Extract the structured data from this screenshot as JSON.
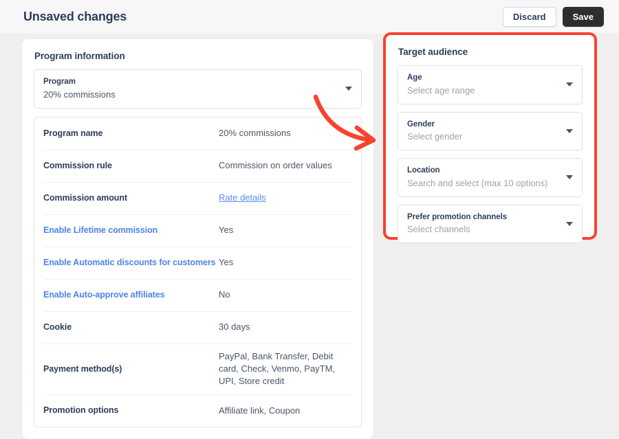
{
  "header": {
    "title": "Unsaved changes",
    "discard_label": "Discard",
    "save_label": "Save"
  },
  "colors": {
    "page_background": "#efeff0",
    "header_background": "#f7f7f8",
    "card_background": "#ffffff",
    "title_text": "#2e3d5c",
    "body_text": "#4a5568",
    "placeholder_text": "#9aa2b0",
    "link_blue": "#5b8def",
    "key_link_blue": "#4f83e8",
    "highlight_red": "#f8432e",
    "save_button_background": "#2e2e30",
    "border": "#dfe1e6"
  },
  "left_panel": {
    "title": "Program information",
    "program_select": {
      "label": "Program",
      "value": "20% commissions",
      "caret_icon": "chevron-down-icon"
    },
    "info_rows": [
      {
        "key": "Program name",
        "key_style": "normal",
        "value": "20% commissions",
        "value_type": "text"
      },
      {
        "key": "Commission rule",
        "key_style": "normal",
        "value": "Commission on order values",
        "value_type": "text"
      },
      {
        "key": "Commission amount",
        "key_style": "normal",
        "value": "Rate details",
        "value_type": "link"
      },
      {
        "key": "Enable Lifetime commission",
        "key_style": "link",
        "value": "Yes",
        "value_type": "text"
      },
      {
        "key": "Enable Automatic discounts for customers",
        "key_style": "link",
        "value": "Yes",
        "value_type": "text"
      },
      {
        "key": "Enable Auto-approve affiliates",
        "key_style": "link",
        "value": "No",
        "value_type": "text"
      },
      {
        "key": "Cookie",
        "key_style": "normal",
        "value": "30 days",
        "value_type": "text"
      },
      {
        "key": "Payment method(s)",
        "key_style": "normal",
        "value": "PayPal, Bank Transfer, Debit card, Check, Venmo, PayTM, UPI, Store credit",
        "value_type": "text"
      },
      {
        "key": "Promotion options",
        "key_style": "normal",
        "value": "Affiliate link, Coupon",
        "value_type": "text"
      }
    ]
  },
  "right_panel": {
    "title": "Target audience",
    "highlighted": true,
    "fields": [
      {
        "label": "Age",
        "placeholder": "Select age range",
        "caret_icon": "chevron-down-icon"
      },
      {
        "label": "Gender",
        "placeholder": "Select gender",
        "caret_icon": "chevron-down-icon"
      },
      {
        "label": "Location",
        "placeholder": "Search and select (max 10 options)",
        "caret_icon": "chevron-down-icon"
      },
      {
        "label": "Prefer promotion channels",
        "placeholder": "Select channels",
        "caret_icon": "chevron-down-icon"
      }
    ]
  },
  "annotation": {
    "arrow_icon": "curved-arrow-icon",
    "arrow_color": "#f8432e",
    "points_to": "Target audience"
  }
}
